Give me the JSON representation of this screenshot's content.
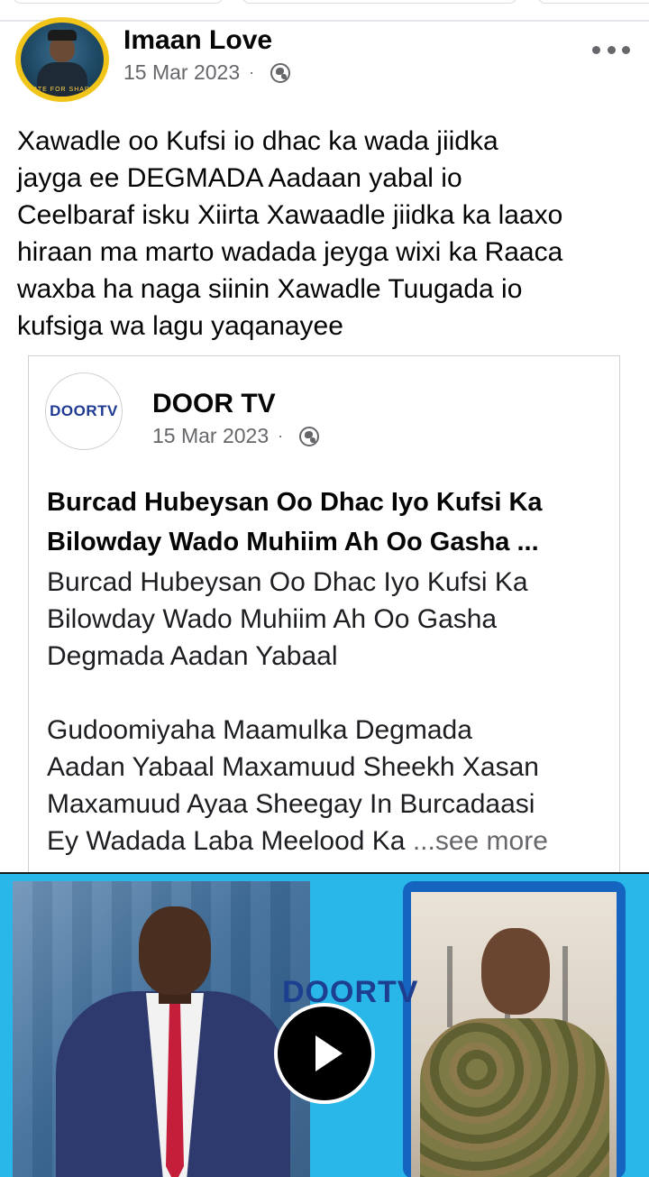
{
  "post": {
    "author": "Imaan Love",
    "date": "15 Mar 2023",
    "dot": "·",
    "avatar_text": "VOTE FOR SHARIF",
    "text": "Xawadle oo Kufsi io dhac ka wada jiidka\njayga ee DEGMADA Aadaan yabal io\nCeelbaraf isku Xiirta Xawaadle jiidka ka laaxo\nhiraan ma marto wadada jeyga wixi ka Raaca\nwaxba ha naga siinin Xawadle Tuugada io\nkufsiga wa lagu yaqanayee"
  },
  "shared": {
    "page_name": "DOOR TV",
    "logo_text": "DOORTV",
    "date": "15 Mar 2023",
    "dot": "·",
    "headline": "Burcad Hubeysan Oo Dhac Iyo  Kufsi Ka\nBilowday Wado Muhiim Ah Oo Gasha ...",
    "body": "Burcad Hubeysan Oo Dhac Iyo  Kufsi Ka\nBilowday Wado Muhiim Ah Oo Gasha\nDegmada Aadan Yabaal\n\nGudoomiyaha Maamulka Degmada\nAadan Yabaal Maxamuud Sheekh Xasan\nMaxamuud Ayaa Sheegay In Burcadaasi\nEy Wadada Laba Meelood Ka ",
    "see_more": "...see more"
  },
  "video": {
    "watermark": "DOORTV"
  },
  "colors": {
    "meta_gray": "#65676b",
    "video_bg": "#29b6e8",
    "frame_blue": "#1565c0"
  },
  "icons": [
    "globe-icon",
    "more-options-icon",
    "play-icon"
  ]
}
